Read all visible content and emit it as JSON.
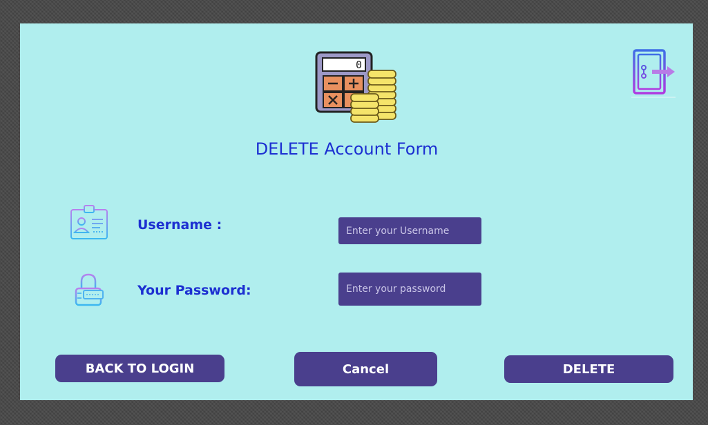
{
  "form": {
    "title": "DELETE Account Form",
    "username_label": "Username :",
    "password_label": "Your Password:",
    "username_placeholder": "Enter your Username",
    "password_placeholder": "Enter your password"
  },
  "buttons": {
    "back_to_login": "BACK TO LOGIN",
    "cancel": "Cancel",
    "delete": "DELETE"
  },
  "calculator_display": "0",
  "icons": {
    "header": "calculator-coins-icon",
    "exit": "exit-door-icon",
    "username": "id-card-icon",
    "password": "padlock-icon"
  },
  "colors": {
    "background": "#b0eeee",
    "accent": "#4a3f8d",
    "label_text": "#1c2fd1"
  }
}
